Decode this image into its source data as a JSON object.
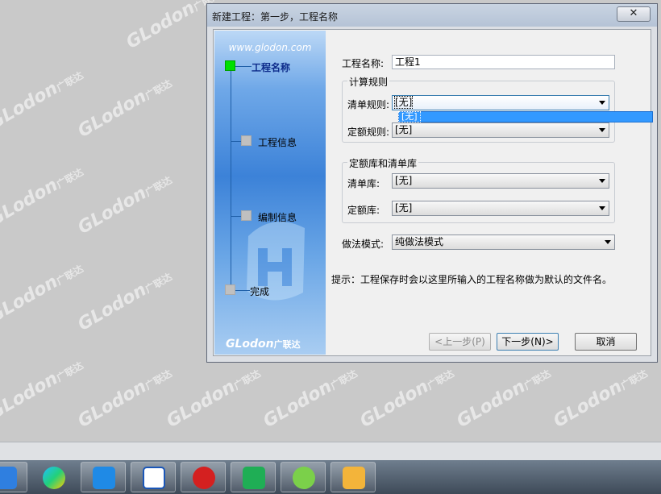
{
  "watermark": {
    "brand": "GLodon",
    "suffix": "广联达"
  },
  "dialog": {
    "title": "新建工程：第一步，工程名称",
    "close_glyph": "✕"
  },
  "banner": {
    "url": "www.glodon.com",
    "steps": [
      "工程名称",
      "工程信息",
      "编制信息",
      "完成"
    ],
    "brand": "GLodon",
    "brand_suffix": "广联达"
  },
  "form": {
    "project_name_label": "工程名称:",
    "project_name_value": "工程1",
    "calc_rules_title": "计算规则",
    "list_rule_label": "清单规则:",
    "list_rule_value": "[无]",
    "list_rule_options": [
      "[无]"
    ],
    "quota_rule_label": "定额规则:",
    "quota_rule_value": "[无]",
    "libs_title": "定额库和清单库",
    "list_lib_label": "清单库:",
    "list_lib_value": "[无]",
    "quota_lib_label": "定额库:",
    "quota_lib_value": "[无]",
    "method_label": "做法模式:",
    "method_value": "纯做法模式",
    "hint": "提示：工程保存时会以这里所输入的工程名称做为默认的文件名。"
  },
  "buttons": {
    "prev": "<上一步(P)",
    "next": "下一步(N)>",
    "cancel": "取消"
  },
  "taskbar": {
    "icons": [
      "baidu-netdisk-icon",
      "tencent-video-icon",
      "sogou-input-icon",
      "word-icon",
      "red-app-icon",
      "glodon-h-icon",
      "refresh-green-icon",
      "notepad-icon"
    ]
  }
}
